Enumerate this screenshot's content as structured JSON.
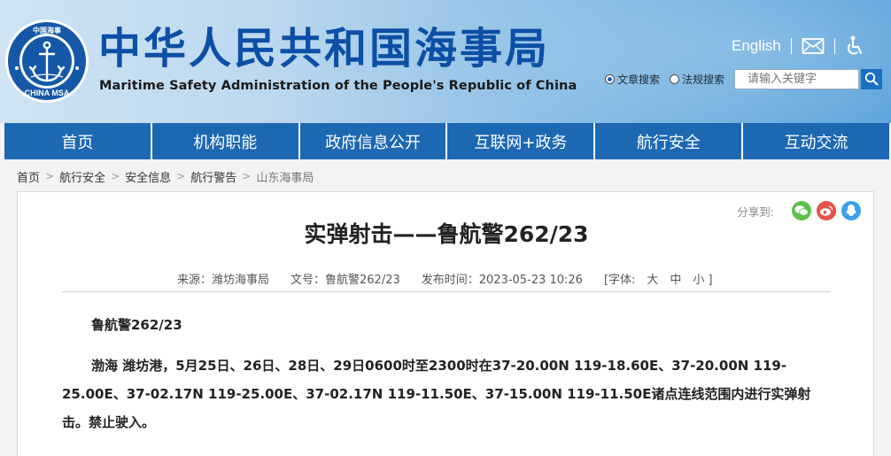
{
  "header": {
    "logo": {
      "name": "China MSA emblem",
      "text_top": "中国海事",
      "text_bottom": "CHINA MSA"
    },
    "title": "中华人民共和国海事局",
    "subtitle": "Maritime Safety Administration of the People's Republic of China",
    "english_link": "English",
    "icons": [
      "mail-icon",
      "accessibility-icon"
    ]
  },
  "search": {
    "options": [
      {
        "label": "文章搜索",
        "selected": true
      },
      {
        "label": "法规搜索",
        "selected": false
      }
    ],
    "placeholder": "请输入关键字"
  },
  "nav": {
    "items": [
      "首页",
      "机构职能",
      "政府信息公开",
      "互联网+政务",
      "航行安全",
      "互动交流"
    ]
  },
  "breadcrumb": [
    "首页",
    "航行安全",
    "安全信息",
    "航行警告",
    "山东海事局"
  ],
  "share": {
    "label": "分享到:",
    "targets": [
      "wechat-icon",
      "weibo-icon",
      "qq-icon"
    ]
  },
  "article": {
    "title": "实弹射击——鲁航警262/23",
    "meta": {
      "source": "来源：潍坊海事局",
      "doc_no": "文号：鲁航警262/23",
      "date": "发布时间：2023-05-23 10:26",
      "font_size": "[字体:　大　中　小 ]"
    },
    "doc_number": "鲁航警262/23",
    "body": "渤海 潍坊港，5月25日、26日、28日、29日0600时至2300时在37-20.00N 119-18.60E、37-20.00N 119-25.00E、37-02.17N 119-25.00E、37-02.17N 119-11.50E、37-15.00N 119-11.50E诸点连线范围内进行实弹射击。禁止驶入。"
  },
  "colors": {
    "nav_bg": "#1d68b3",
    "title_blue": "#0b4fa6",
    "accent": "#1a6fc4"
  }
}
